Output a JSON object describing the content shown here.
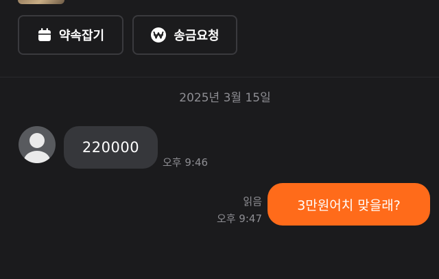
{
  "actions": {
    "appointment": {
      "label": "약속잡기",
      "icon": "calendar-icon"
    },
    "remit_request": {
      "label": "송금요청",
      "icon": "won-coin-icon"
    }
  },
  "chat": {
    "date_separator": "2025년 3월 15일",
    "messages": [
      {
        "direction": "incoming",
        "text": "220000",
        "time": "오후 9:46"
      },
      {
        "direction": "outgoing",
        "text": "3만원어치 맞을래?",
        "time": "오후 9:47",
        "read_label": "읽음"
      }
    ]
  },
  "colors": {
    "background": "#1b1b1d",
    "incoming_bubble": "#36373b",
    "outgoing_bubble": "#ff6b1a",
    "muted_text": "#8e8e93"
  }
}
